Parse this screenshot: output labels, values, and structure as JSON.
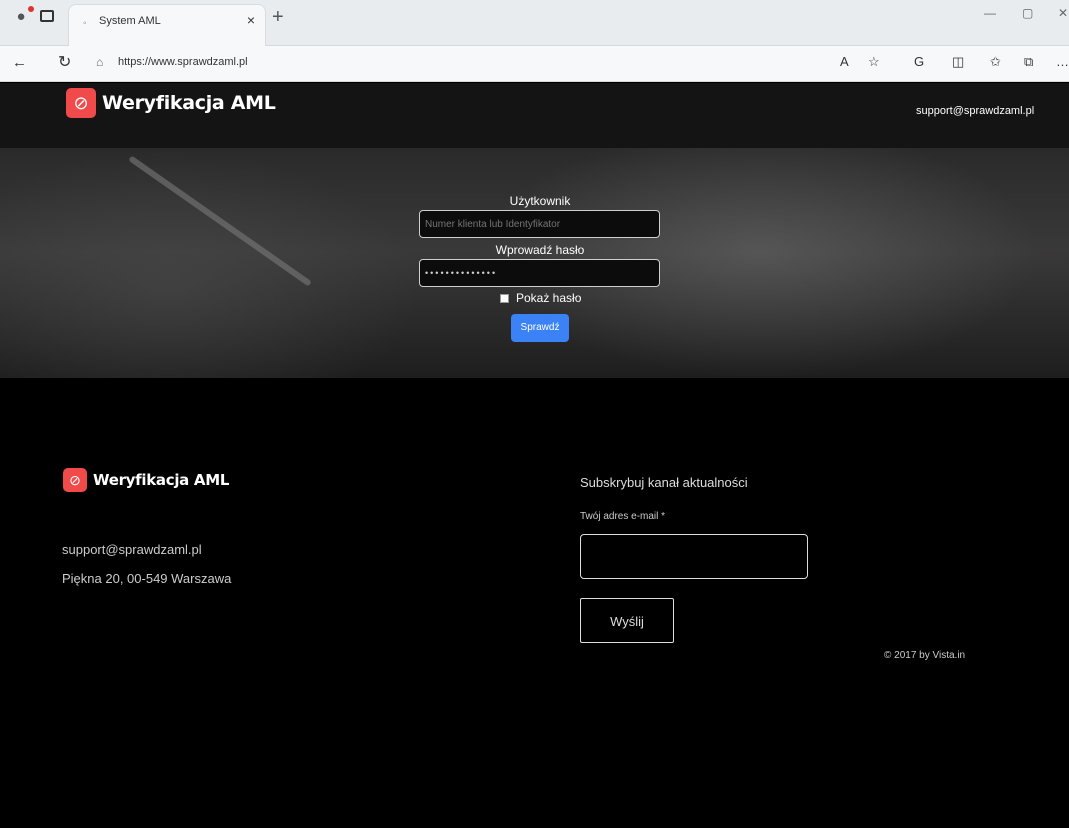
{
  "browser": {
    "tab_title": "System AML",
    "tab_close": "×",
    "new_tab": "+",
    "url": "https://www.sprawdzaml.pl",
    "window_min": "—",
    "window_max": "▢",
    "window_close": "✕"
  },
  "header": {
    "logo_text": "Weryfikacja AML",
    "email": "support@sprawdzaml.pl"
  },
  "login": {
    "user_label": "Użytkownik",
    "user_placeholder": "Numer klienta lub Identyfikator",
    "user_value": "",
    "password_label": "Wprowadź hasło",
    "password_value": "••••••••••••••",
    "show_password_label": "Pokaż hasło",
    "show_password_checked": false,
    "submit_label": "Sprawdź"
  },
  "footer": {
    "logo_text": "Weryfikacja AML",
    "email": "support@sprawdzaml.pl",
    "address": "Piękna 20, 00-549 Warszawa",
    "subscribe_title": "Subskrybuj kanał aktualności",
    "email_label": "Twój adres e-mail *",
    "email_value": "",
    "send_label": "Wyślij",
    "copyright": "© 2017 by Vista.in"
  },
  "colors": {
    "accent": "#3b82f6",
    "logo_badge": "#f04a4a",
    "header_bg": "#141414",
    "page_bg": "#000000"
  }
}
